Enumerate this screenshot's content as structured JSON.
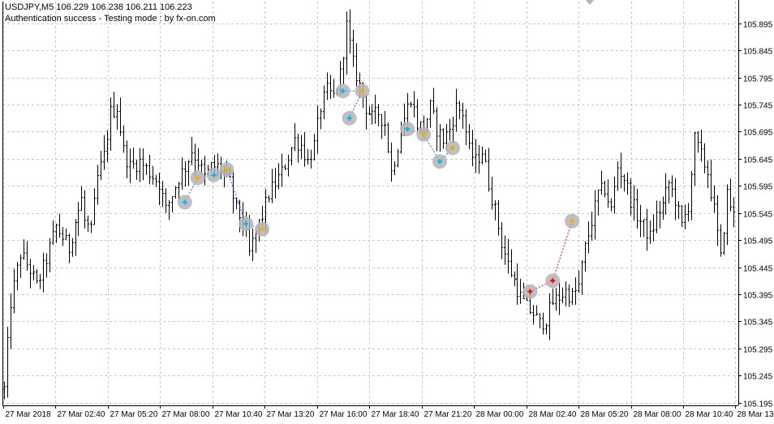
{
  "header": {
    "line1": "USDJPY,M5  106.229 106.238 106.211 106.223",
    "line2": "Authentication success - Testing mode : by fx-on.com"
  },
  "colors": {
    "background": "#ffffff",
    "grid": "#c8c8c8",
    "bars": "#000000",
    "buy_marker": "#00b4ff",
    "sell_marker": "#ffa500",
    "exit_marker": "#ff0000",
    "marker_halo": "#b4b4b4"
  },
  "chart_data": {
    "type": "ohlc",
    "symbol": "USDJPY",
    "timeframe": "M5",
    "grid": true,
    "ylim": [
      105.19,
      105.935
    ],
    "y_ticks": [
      "105.895",
      "105.845",
      "105.795",
      "105.745",
      "105.695",
      "105.645",
      "105.595",
      "105.545",
      "105.495",
      "105.445",
      "105.395",
      "105.345",
      "105.295",
      "105.245",
      "105.195"
    ],
    "x_ticks": [
      "27 Mar 2018",
      "27 Mar 02:40",
      "27 Mar 05:20",
      "27 Mar 08:00",
      "27 Mar 10:40",
      "27 Mar 13:20",
      "27 Mar 16:00",
      "27 Mar 18:40",
      "27 Mar 21:20",
      "28 Mar 00:00",
      "28 Mar 02:40",
      "28 Mar 05:20",
      "28 Mar 08:00",
      "28 Mar 10:40",
      "28 Mar 13:20"
    ],
    "price_path": [
      [
        0,
        105.22
      ],
      [
        2,
        105.38
      ],
      [
        5,
        105.47
      ],
      [
        8,
        105.44
      ],
      [
        10,
        105.41
      ],
      [
        13,
        105.46
      ],
      [
        16,
        105.52
      ],
      [
        18,
        105.5
      ],
      [
        20,
        105.48
      ],
      [
        22,
        105.53
      ],
      [
        24,
        105.57
      ],
      [
        25,
        105.53
      ],
      [
        27,
        105.51
      ],
      [
        29,
        105.61
      ],
      [
        31,
        105.65
      ],
      [
        33,
        105.73
      ],
      [
        35,
        105.74
      ],
      [
        37,
        105.66
      ],
      [
        39,
        105.63
      ],
      [
        42,
        105.64
      ],
      [
        45,
        105.62
      ],
      [
        48,
        105.6
      ],
      [
        50,
        105.55
      ],
      [
        52,
        105.58
      ],
      [
        54,
        105.61
      ],
      [
        56,
        105.63
      ],
      [
        58,
        105.66
      ],
      [
        60,
        105.64
      ],
      [
        62,
        105.61
      ],
      [
        64,
        105.63
      ],
      [
        66,
        105.63
      ],
      [
        68,
        105.62
      ],
      [
        70,
        105.6
      ],
      [
        72,
        105.55
      ],
      [
        74,
        105.53
      ],
      [
        76,
        105.47
      ],
      [
        78,
        105.51
      ],
      [
        80,
        105.54
      ],
      [
        82,
        105.58
      ],
      [
        84,
        105.6
      ],
      [
        86,
        105.62
      ],
      [
        88,
        105.65
      ],
      [
        90,
        105.68
      ],
      [
        92,
        105.67
      ],
      [
        94,
        105.64
      ],
      [
        96,
        105.67
      ],
      [
        98,
        105.74
      ],
      [
        100,
        105.77
      ],
      [
        102,
        105.76
      ],
      [
        104,
        105.8
      ],
      [
        106,
        105.89
      ],
      [
        108,
        105.82
      ],
      [
        110,
        105.78
      ],
      [
        112,
        105.74
      ],
      [
        114,
        105.72
      ],
      [
        116,
        105.73
      ],
      [
        118,
        105.71
      ],
      [
        120,
        105.62
      ],
      [
        122,
        105.67
      ],
      [
        124,
        105.72
      ],
      [
        126,
        105.76
      ],
      [
        128,
        105.71
      ],
      [
        130,
        105.7
      ],
      [
        132,
        105.74
      ],
      [
        134,
        105.7
      ],
      [
        136,
        105.68
      ],
      [
        138,
        105.7
      ],
      [
        140,
        105.74
      ],
      [
        142,
        105.73
      ],
      [
        144,
        105.66
      ],
      [
        146,
        105.64
      ],
      [
        148,
        105.66
      ],
      [
        150,
        105.6
      ],
      [
        152,
        105.55
      ],
      [
        154,
        105.49
      ],
      [
        156,
        105.45
      ],
      [
        158,
        105.42
      ],
      [
        160,
        105.39
      ],
      [
        162,
        105.37
      ],
      [
        164,
        105.36
      ],
      [
        166,
        105.34
      ],
      [
        168,
        105.35
      ],
      [
        170,
        105.38
      ],
      [
        172,
        105.39
      ],
      [
        174,
        105.4
      ],
      [
        176,
        105.39
      ],
      [
        178,
        105.41
      ],
      [
        180,
        105.48
      ],
      [
        182,
        105.53
      ],
      [
        184,
        105.58
      ],
      [
        186,
        105.59
      ],
      [
        188,
        105.55
      ],
      [
        190,
        105.63
      ],
      [
        192,
        105.61
      ],
      [
        194,
        105.57
      ],
      [
        196,
        105.54
      ],
      [
        198,
        105.52
      ],
      [
        200,
        105.5
      ],
      [
        202,
        105.54
      ],
      [
        204,
        105.56
      ],
      [
        206,
        105.6
      ],
      [
        208,
        105.57
      ],
      [
        210,
        105.52
      ],
      [
        212,
        105.56
      ],
      [
        214,
        105.68
      ],
      [
        216,
        105.65
      ],
      [
        218,
        105.62
      ],
      [
        220,
        105.55
      ],
      [
        222,
        105.46
      ],
      [
        224,
        105.58
      ],
      [
        226,
        105.54
      ]
    ],
    "trade_markers": [
      {
        "kind": "buy",
        "bar": 56,
        "price": 105.565
      },
      {
        "kind": "sell",
        "bar": 60,
        "price": 105.61
      },
      {
        "kind": "buy",
        "bar": 65,
        "price": 105.615
      },
      {
        "kind": "sell",
        "bar": 69,
        "price": 105.625
      },
      {
        "kind": "buy",
        "bar": 75,
        "price": 105.525
      },
      {
        "kind": "sell",
        "bar": 80,
        "price": 105.515
      },
      {
        "kind": "buy",
        "bar": 105,
        "price": 105.77
      },
      {
        "kind": "sell",
        "bar": 111,
        "price": 105.77
      },
      {
        "kind": "buy",
        "bar": 107,
        "price": 105.72
      },
      {
        "kind": "buy",
        "bar": 125,
        "price": 105.7
      },
      {
        "kind": "sell",
        "bar": 130,
        "price": 105.69
      },
      {
        "kind": "buy",
        "bar": 135,
        "price": 105.64
      },
      {
        "kind": "sell",
        "bar": 139,
        "price": 105.665
      },
      {
        "kind": "exit",
        "bar": 163,
        "price": 105.4
      },
      {
        "kind": "exit",
        "bar": 170,
        "price": 105.42
      },
      {
        "kind": "sell",
        "bar": 176,
        "price": 105.53
      }
    ]
  }
}
